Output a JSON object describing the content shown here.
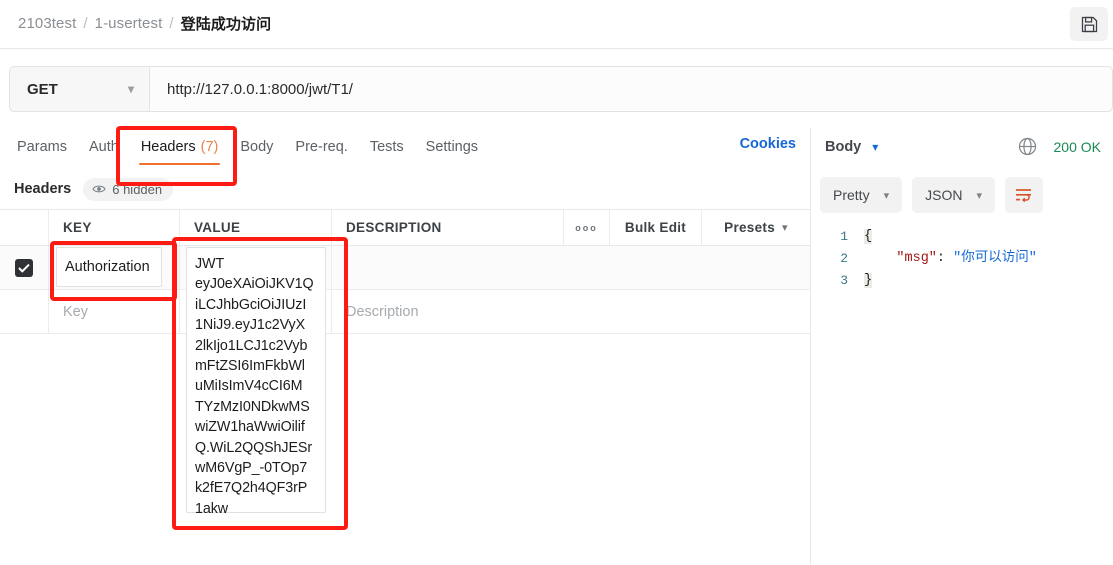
{
  "breadcrumb": {
    "items": [
      "2103test",
      "1-usertest",
      "登陆成功访问"
    ],
    "separator": "/"
  },
  "toolbar": {
    "save_icon": "save-floppy-icon"
  },
  "request": {
    "method": "GET",
    "url": "http://127.0.0.1:8000/jwt/T1/",
    "tabs": [
      {
        "label": "Params",
        "count": "",
        "active": false
      },
      {
        "label": "Auth",
        "count": "",
        "active": false
      },
      {
        "label": "Headers",
        "count": "(7)",
        "active": true
      },
      {
        "label": "Body",
        "count": "",
        "active": false
      },
      {
        "label": "Pre-req.",
        "count": "",
        "active": false
      },
      {
        "label": "Tests",
        "count": "",
        "active": false
      },
      {
        "label": "Settings",
        "count": "",
        "active": false
      }
    ],
    "cookies_label": "Cookies",
    "headers_section": {
      "title": "Headers",
      "hidden_label": "6 hidden",
      "eye_icon": "eye-icon"
    },
    "table": {
      "columns": [
        "KEY",
        "VALUE",
        "DESCRIPTION"
      ],
      "more_options": "ooo",
      "bulk_edit_label": "Bulk Edit",
      "presets_label": "Presets",
      "rows": [
        {
          "checked": true,
          "key": "Authorization",
          "value_lines": [
            "JWT",
            "eyJ0eXAiOiJKV1Q",
            "iLCJhbGciOiJIUzI",
            "1NiJ9.eyJ1c2VyX",
            "2lkIjo1LCJ1c2Vyb",
            "mFtZSI6ImFkbWl",
            "uMiIsImV4cCI6M",
            "TYzMzI0NDkwMS",
            "wiZW1haWwiOilif",
            "Q.WiL2QQShJESr",
            "wM6VgP_-0TOp7",
            "k2fE7Q2h4QF3rP",
            "1akw"
          ],
          "description": ""
        },
        {
          "checked": false,
          "key_placeholder": "Key",
          "value_placeholder": "",
          "description_placeholder": "Description"
        }
      ]
    }
  },
  "response": {
    "body_label": "Body",
    "globe_icon": "globe-icon",
    "status": "200 OK",
    "format_label": "Pretty",
    "language_label": "JSON",
    "wrap_icon": "word-wrap-icon",
    "code_lines": [
      {
        "number": "1",
        "brace": "{",
        "key": "",
        "punct": "",
        "value": ""
      },
      {
        "number": "2",
        "brace": "",
        "key": "\"msg\"",
        "punct": ": ",
        "value": "\"你可以访问\""
      },
      {
        "number": "3",
        "brace": "}",
        "key": "",
        "punct": "",
        "value": ""
      }
    ]
  },
  "annotations": {
    "colors": {
      "highlight": "#fc1c13",
      "accent": "#f06f31",
      "link": "#1667d6",
      "success": "#1a8a54"
    },
    "boxes": [
      "headers-tab",
      "authorization-key",
      "jwt-value"
    ]
  }
}
